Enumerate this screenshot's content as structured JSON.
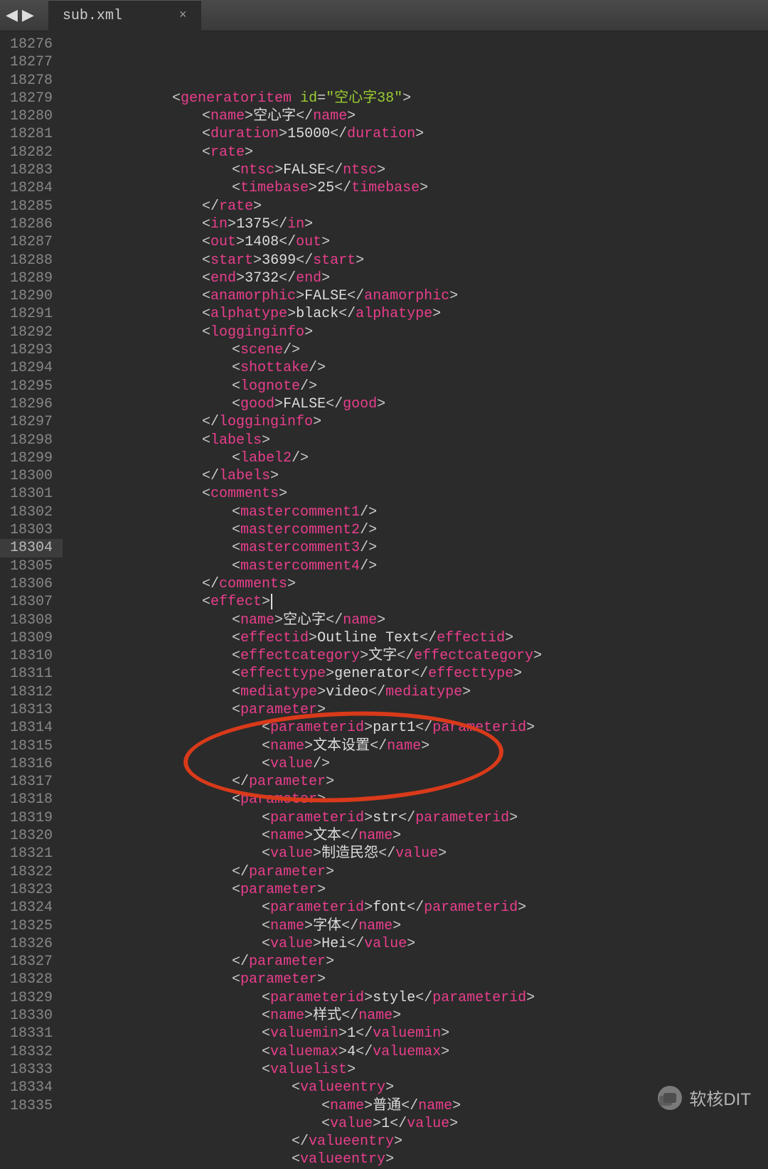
{
  "tab": {
    "filename": "sub.xml",
    "close_label": "×"
  },
  "nav": {
    "back": "◀",
    "forward": "▶"
  },
  "watermark": {
    "text": "软核DIT"
  },
  "highlight_line_index": 28,
  "annotation_circle": {
    "top_line_index": 38,
    "height_lines": 5
  },
  "lines": [
    {
      "num": 18276,
      "indent": 6,
      "html": "<span class='p'>&lt;</span><span class='t'>generatoritem</span> <span class='a'>id</span><span class='p'>=</span><span class='s'>\"空心字38\"</span><span class='p'>&gt;</span>"
    },
    {
      "num": 18277,
      "indent": 7,
      "html": "<span class='p'>&lt;</span><span class='t'>name</span><span class='p'>&gt;</span><span class='tx'>空心字</span><span class='p'>&lt;/</span><span class='t'>name</span><span class='p'>&gt;</span>"
    },
    {
      "num": 18278,
      "indent": 7,
      "html": "<span class='p'>&lt;</span><span class='t'>duration</span><span class='p'>&gt;</span><span class='tx'>15000</span><span class='p'>&lt;/</span><span class='t'>duration</span><span class='p'>&gt;</span>"
    },
    {
      "num": 18279,
      "indent": 7,
      "html": "<span class='p'>&lt;</span><span class='t'>rate</span><span class='p'>&gt;</span>"
    },
    {
      "num": 18280,
      "indent": 8,
      "html": "<span class='p'>&lt;</span><span class='t'>ntsc</span><span class='p'>&gt;</span><span class='tx'>FALSE</span><span class='p'>&lt;/</span><span class='t'>ntsc</span><span class='p'>&gt;</span>"
    },
    {
      "num": 18281,
      "indent": 8,
      "html": "<span class='p'>&lt;</span><span class='t'>timebase</span><span class='p'>&gt;</span><span class='tx'>25</span><span class='p'>&lt;/</span><span class='t'>timebase</span><span class='p'>&gt;</span>"
    },
    {
      "num": 18282,
      "indent": 7,
      "html": "<span class='p'>&lt;/</span><span class='t'>rate</span><span class='p'>&gt;</span>"
    },
    {
      "num": 18283,
      "indent": 7,
      "html": "<span class='p'>&lt;</span><span class='t'>in</span><span class='p'>&gt;</span><span class='tx'>1375</span><span class='p'>&lt;/</span><span class='t'>in</span><span class='p'>&gt;</span>"
    },
    {
      "num": 18284,
      "indent": 7,
      "html": "<span class='p'>&lt;</span><span class='t'>out</span><span class='p'>&gt;</span><span class='tx'>1408</span><span class='p'>&lt;/</span><span class='t'>out</span><span class='p'>&gt;</span>"
    },
    {
      "num": 18285,
      "indent": 7,
      "html": "<span class='p'>&lt;</span><span class='t'>start</span><span class='p'>&gt;</span><span class='tx'>3699</span><span class='p'>&lt;/</span><span class='t'>start</span><span class='p'>&gt;</span>"
    },
    {
      "num": 18286,
      "indent": 7,
      "html": "<span class='p'>&lt;</span><span class='t'>end</span><span class='p'>&gt;</span><span class='tx'>3732</span><span class='p'>&lt;/</span><span class='t'>end</span><span class='p'>&gt;</span>"
    },
    {
      "num": 18287,
      "indent": 7,
      "html": "<span class='p'>&lt;</span><span class='t'>anamorphic</span><span class='p'>&gt;</span><span class='tx'>FALSE</span><span class='p'>&lt;/</span><span class='t'>anamorphic</span><span class='p'>&gt;</span>"
    },
    {
      "num": 18288,
      "indent": 7,
      "html": "<span class='p'>&lt;</span><span class='t'>alphatype</span><span class='p'>&gt;</span><span class='tx'>black</span><span class='p'>&lt;/</span><span class='t'>alphatype</span><span class='p'>&gt;</span>"
    },
    {
      "num": 18289,
      "indent": 7,
      "html": "<span class='p'>&lt;</span><span class='t'>logginginfo</span><span class='p'>&gt;</span>"
    },
    {
      "num": 18290,
      "indent": 8,
      "html": "<span class='p'>&lt;</span><span class='t'>scene</span><span class='p'>/&gt;</span>"
    },
    {
      "num": 18291,
      "indent": 8,
      "html": "<span class='p'>&lt;</span><span class='t'>shottake</span><span class='p'>/&gt;</span>"
    },
    {
      "num": 18292,
      "indent": 8,
      "html": "<span class='p'>&lt;</span><span class='t'>lognote</span><span class='p'>/&gt;</span>"
    },
    {
      "num": 18293,
      "indent": 8,
      "html": "<span class='p'>&lt;</span><span class='t'>good</span><span class='p'>&gt;</span><span class='tx'>FALSE</span><span class='p'>&lt;/</span><span class='t'>good</span><span class='p'>&gt;</span>"
    },
    {
      "num": 18294,
      "indent": 7,
      "html": "<span class='p'>&lt;/</span><span class='t'>logginginfo</span><span class='p'>&gt;</span>"
    },
    {
      "num": 18295,
      "indent": 7,
      "html": "<span class='p'>&lt;</span><span class='t'>labels</span><span class='p'>&gt;</span>"
    },
    {
      "num": 18296,
      "indent": 8,
      "html": "<span class='p'>&lt;</span><span class='t'>label2</span><span class='p'>/&gt;</span>"
    },
    {
      "num": 18297,
      "indent": 7,
      "html": "<span class='p'>&lt;/</span><span class='t'>labels</span><span class='p'>&gt;</span>"
    },
    {
      "num": 18298,
      "indent": 7,
      "html": "<span class='p'>&lt;</span><span class='t'>comments</span><span class='p'>&gt;</span>"
    },
    {
      "num": 18299,
      "indent": 8,
      "html": "<span class='p'>&lt;</span><span class='t'>mastercomment1</span><span class='p'>/&gt;</span>"
    },
    {
      "num": 18300,
      "indent": 8,
      "html": "<span class='p'>&lt;</span><span class='t'>mastercomment2</span><span class='p'>/&gt;</span>"
    },
    {
      "num": 18301,
      "indent": 8,
      "html": "<span class='p'>&lt;</span><span class='t'>mastercomment3</span><span class='p'>/&gt;</span>"
    },
    {
      "num": 18302,
      "indent": 8,
      "html": "<span class='p'>&lt;</span><span class='t'>mastercomment4</span><span class='p'>/&gt;</span>"
    },
    {
      "num": 18303,
      "indent": 7,
      "html": "<span class='p'>&lt;/</span><span class='t'>comments</span><span class='p'>&gt;</span>"
    },
    {
      "num": 18304,
      "indent": 7,
      "html": "<span class='p'>&lt;</span><span class='t'>effect</span><span class='p'>&gt;</span><span class='cursor'></span>"
    },
    {
      "num": 18305,
      "indent": 8,
      "html": "<span class='p'>&lt;</span><span class='t'>name</span><span class='p'>&gt;</span><span class='tx'>空心字</span><span class='p'>&lt;/</span><span class='t'>name</span><span class='p'>&gt;</span>"
    },
    {
      "num": 18306,
      "indent": 8,
      "html": "<span class='p'>&lt;</span><span class='t'>effectid</span><span class='p'>&gt;</span><span class='tx'>Outline Text</span><span class='p'>&lt;/</span><span class='t'>effectid</span><span class='p'>&gt;</span>"
    },
    {
      "num": 18307,
      "indent": 8,
      "html": "<span class='p'>&lt;</span><span class='t'>effectcategory</span><span class='p'>&gt;</span><span class='tx'>文字</span><span class='p'>&lt;/</span><span class='t'>effectcategory</span><span class='p'>&gt;</span>"
    },
    {
      "num": 18308,
      "indent": 8,
      "html": "<span class='p'>&lt;</span><span class='t'>effecttype</span><span class='p'>&gt;</span><span class='tx'>generator</span><span class='p'>&lt;/</span><span class='t'>effecttype</span><span class='p'>&gt;</span>"
    },
    {
      "num": 18309,
      "indent": 8,
      "html": "<span class='p'>&lt;</span><span class='t'>mediatype</span><span class='p'>&gt;</span><span class='tx'>video</span><span class='p'>&lt;/</span><span class='t'>mediatype</span><span class='p'>&gt;</span>"
    },
    {
      "num": 18310,
      "indent": 8,
      "html": "<span class='p'>&lt;</span><span class='t'>parameter</span><span class='p'>&gt;</span>"
    },
    {
      "num": 18311,
      "indent": 9,
      "html": "<span class='p'>&lt;</span><span class='t'>parameterid</span><span class='p'>&gt;</span><span class='tx'>part1</span><span class='p'>&lt;/</span><span class='t'>parameterid</span><span class='p'>&gt;</span>"
    },
    {
      "num": 18312,
      "indent": 9,
      "html": "<span class='p'>&lt;</span><span class='t'>name</span><span class='p'>&gt;</span><span class='tx'>文本设置</span><span class='p'>&lt;/</span><span class='t'>name</span><span class='p'>&gt;</span>"
    },
    {
      "num": 18313,
      "indent": 9,
      "html": "<span class='p'>&lt;</span><span class='t'>value</span><span class='p'>/&gt;</span>"
    },
    {
      "num": 18314,
      "indent": 8,
      "html": "<span class='p'>&lt;/</span><span class='t'>parameter</span><span class='p'>&gt;</span>"
    },
    {
      "num": 18315,
      "indent": 8,
      "html": "<span class='p'>&lt;</span><span class='t'>parameter</span><span class='p'>&gt;</span>"
    },
    {
      "num": 18316,
      "indent": 9,
      "html": "<span class='p'>&lt;</span><span class='t'>parameterid</span><span class='p'>&gt;</span><span class='tx'>str</span><span class='p'>&lt;/</span><span class='t'>parameterid</span><span class='p'>&gt;</span>"
    },
    {
      "num": 18317,
      "indent": 9,
      "html": "<span class='p'>&lt;</span><span class='t'>name</span><span class='p'>&gt;</span><span class='tx'>文本</span><span class='p'>&lt;/</span><span class='t'>name</span><span class='p'>&gt;</span>"
    },
    {
      "num": 18318,
      "indent": 9,
      "html": "<span class='p'>&lt;</span><span class='t'>value</span><span class='p'>&gt;</span><span class='tx'>制造民怨</span><span class='p'>&lt;/</span><span class='t'>value</span><span class='p'>&gt;</span>"
    },
    {
      "num": 18319,
      "indent": 8,
      "html": "<span class='p'>&lt;/</span><span class='t'>parameter</span><span class='p'>&gt;</span>"
    },
    {
      "num": 18320,
      "indent": 8,
      "html": "<span class='p'>&lt;</span><span class='t'>parameter</span><span class='p'>&gt;</span>"
    },
    {
      "num": 18321,
      "indent": 9,
      "html": "<span class='p'>&lt;</span><span class='t'>parameterid</span><span class='p'>&gt;</span><span class='tx'>font</span><span class='p'>&lt;/</span><span class='t'>parameterid</span><span class='p'>&gt;</span>"
    },
    {
      "num": 18322,
      "indent": 9,
      "html": "<span class='p'>&lt;</span><span class='t'>name</span><span class='p'>&gt;</span><span class='tx'>字体</span><span class='p'>&lt;/</span><span class='t'>name</span><span class='p'>&gt;</span>"
    },
    {
      "num": 18323,
      "indent": 9,
      "html": "<span class='p'>&lt;</span><span class='t'>value</span><span class='p'>&gt;</span><span class='tx'>Hei</span><span class='p'>&lt;/</span><span class='t'>value</span><span class='p'>&gt;</span>"
    },
    {
      "num": 18324,
      "indent": 8,
      "html": "<span class='p'>&lt;/</span><span class='t'>parameter</span><span class='p'>&gt;</span>"
    },
    {
      "num": 18325,
      "indent": 8,
      "html": "<span class='p'>&lt;</span><span class='t'>parameter</span><span class='p'>&gt;</span>"
    },
    {
      "num": 18326,
      "indent": 9,
      "html": "<span class='p'>&lt;</span><span class='t'>parameterid</span><span class='p'>&gt;</span><span class='tx'>style</span><span class='p'>&lt;/</span><span class='t'>parameterid</span><span class='p'>&gt;</span>"
    },
    {
      "num": 18327,
      "indent": 9,
      "html": "<span class='p'>&lt;</span><span class='t'>name</span><span class='p'>&gt;</span><span class='tx'>样式</span><span class='p'>&lt;/</span><span class='t'>name</span><span class='p'>&gt;</span>"
    },
    {
      "num": 18328,
      "indent": 9,
      "html": "<span class='p'>&lt;</span><span class='t'>valuemin</span><span class='p'>&gt;</span><span class='tx'>1</span><span class='p'>&lt;/</span><span class='t'>valuemin</span><span class='p'>&gt;</span>"
    },
    {
      "num": 18329,
      "indent": 9,
      "html": "<span class='p'>&lt;</span><span class='t'>valuemax</span><span class='p'>&gt;</span><span class='tx'>4</span><span class='p'>&lt;/</span><span class='t'>valuemax</span><span class='p'>&gt;</span>"
    },
    {
      "num": 18330,
      "indent": 9,
      "html": "<span class='p'>&lt;</span><span class='t'>valuelist</span><span class='p'>&gt;</span>"
    },
    {
      "num": 18331,
      "indent": 10,
      "html": "<span class='p'>&lt;</span><span class='t'>valueentry</span><span class='p'>&gt;</span>"
    },
    {
      "num": 18332,
      "indent": 11,
      "html": "<span class='p'>&lt;</span><span class='t'>name</span><span class='p'>&gt;</span><span class='tx'>普通</span><span class='p'>&lt;/</span><span class='t'>name</span><span class='p'>&gt;</span>"
    },
    {
      "num": 18333,
      "indent": 11,
      "html": "<span class='p'>&lt;</span><span class='t'>value</span><span class='p'>&gt;</span><span class='tx'>1</span><span class='p'>&lt;/</span><span class='t'>value</span><span class='p'>&gt;</span>"
    },
    {
      "num": 18334,
      "indent": 10,
      "html": "<span class='p'>&lt;/</span><span class='t'>valueentry</span><span class='p'>&gt;</span>"
    },
    {
      "num": 18335,
      "indent": 10,
      "html": "<span class='p'>&lt;</span><span class='t'>valueentry</span><span class='p'>&gt;</span>"
    }
  ]
}
